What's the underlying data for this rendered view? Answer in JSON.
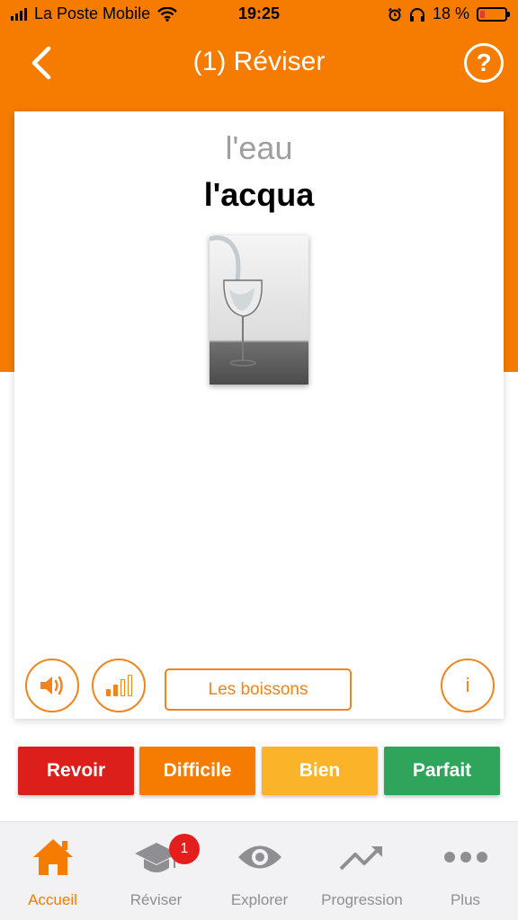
{
  "status_bar": {
    "carrier": "La Poste Mobile",
    "time": "19:25",
    "battery_percent": "18 %",
    "battery_level": 0.18,
    "icons": [
      "signal-icon",
      "wifi-icon",
      "alarm-icon",
      "headphones-icon",
      "battery-icon"
    ]
  },
  "header": {
    "title": "(1) Réviser",
    "back_icon": "chevron-left-icon",
    "help_icon": "help-circle-icon",
    "help_symbol": "?"
  },
  "card": {
    "source_word": "l'eau",
    "target_word": "l'acqua",
    "image_description_icon": "glass-of-water-image",
    "audio_icon": "speaker-icon",
    "level_icon": "signal-level-icon",
    "level": "2/4",
    "category": "Les boissons",
    "info_symbol": "i"
  },
  "answers": [
    {
      "label": "Revoir",
      "color": "#dd1f1c"
    },
    {
      "label": "Difficile",
      "color": "#f57c00"
    },
    {
      "label": "Bien",
      "color": "#fbb42a"
    },
    {
      "label": "Parfait",
      "color": "#2ea55b"
    }
  ],
  "tab_bar": {
    "items": [
      {
        "label": "Accueil",
        "icon": "home-icon",
        "active": true
      },
      {
        "label": "Réviser",
        "icon": "graduation-cap-icon",
        "active": false,
        "badge": "1"
      },
      {
        "label": "Explorer",
        "icon": "eye-icon",
        "active": false
      },
      {
        "label": "Progression",
        "icon": "trending-up-icon",
        "active": false
      },
      {
        "label": "Plus",
        "icon": "more-dots-icon",
        "active": false
      }
    ]
  },
  "colors": {
    "brand_orange": "#f57c00",
    "accent_orange": "#f2841b",
    "inactive_gray": "#8e8e93",
    "badge_red": "#e51d1d"
  }
}
